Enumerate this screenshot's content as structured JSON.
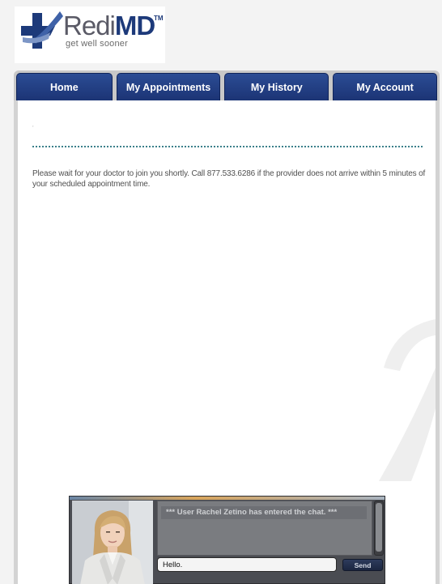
{
  "brand": {
    "name_light": "Redi",
    "name_bold": "MD",
    "trademark": "TM",
    "tagline": "get well sooner",
    "colors": {
      "primary": "#1d3a7a",
      "gray": "#5a5a66"
    }
  },
  "nav": {
    "tabs": [
      {
        "label": "Home"
      },
      {
        "label": "My Appointments"
      },
      {
        "label": "My History"
      },
      {
        "label": "My Account"
      }
    ],
    "tab_color": "#1c3475"
  },
  "main": {
    "small_mark": ",",
    "wait_message": "Please wait for your doctor to join you shortly. Call 877.533.6286 if the provider does not arrive within 5 minutes of your scheduled appointment time."
  },
  "chat": {
    "messages": [
      {
        "text": "*** User Rachel Zetino has entered the chat. ***"
      }
    ],
    "input_value": "Hello.",
    "send_label": "Send"
  }
}
